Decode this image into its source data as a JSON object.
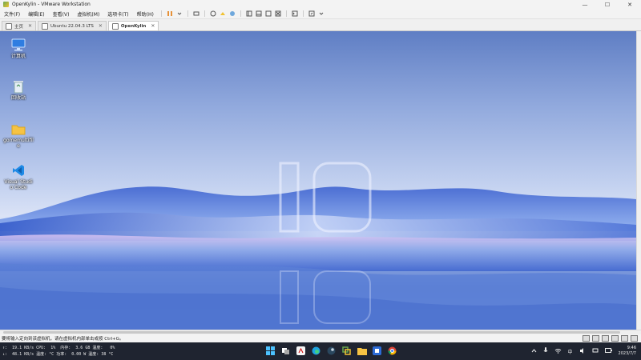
{
  "window": {
    "title": "OpenKylin - VMware Workstation",
    "minimize": "—",
    "maximize": "☐",
    "close": "✕"
  },
  "menu": {
    "items": [
      "文件(F)",
      "编辑(E)",
      "查看(V)",
      "虚拟机(M)",
      "选项卡(T)",
      "帮助(H)"
    ]
  },
  "tabs": [
    {
      "label": "主页",
      "active": false
    },
    {
      "label": "Ubuntu 22.04.3 LTS",
      "active": false
    },
    {
      "label": "OpenKylin",
      "active": true
    }
  ],
  "desktop": {
    "icons": [
      {
        "name": "computer-icon",
        "label": "计算机"
      },
      {
        "name": "recycle-bin-icon",
        "label": "回收站"
      },
      {
        "name": "folder-icon",
        "label": "gomemultifile"
      },
      {
        "name": "vscode-icon",
        "label": "Visual Studio Code"
      }
    ],
    "logo_text": "10"
  },
  "status": {
    "message": "要将输入定向到该虚拟机，请在虚拟机内部单击或按 Ctrl+G。"
  },
  "taskbar": {
    "stats_line1": "↑:  19.1 KB/s CPU:  1%  内存:  3.6 GB 温度:   0%",
    "stats_line2": "↓:  48.1 KB/s 温度: °C 功率:  0.00 W 温度: 38 °C",
    "tray_lang": "中",
    "time": "9:46",
    "date": "2023/7/7"
  },
  "colors": {
    "taskbar": "#1f2430",
    "desktop_top": "#5f7ec4",
    "desktop_mid": "#dbe3f6",
    "desktop_bottom": "#5e80d2"
  }
}
